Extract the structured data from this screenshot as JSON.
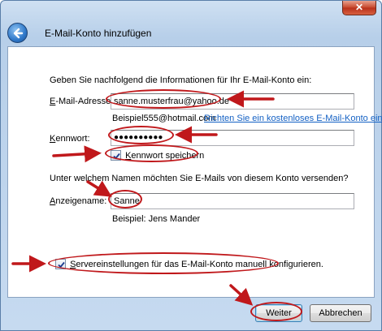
{
  "window": {
    "title": "E-Mail-Konto hinzufügen",
    "close_glyph": "✕",
    "back_icon": "back-arrow-icon"
  },
  "form": {
    "intro": "Geben Sie nachfolgend die Informationen für Ihr E-Mail-Konto ein:",
    "email_label_key": "E",
    "email_label_rest": "-Mail-Adresse:",
    "email_value": "sanne.musterfrau@yahoo.de",
    "email_example": "Beispiel555@hotmail.com",
    "free_account_link": "Richten Sie ein kostenloses E-Mail-Konto ein.",
    "password_label_key": "K",
    "password_label_rest": "ennwort:",
    "password_value": "●●●●●●●●●●",
    "remember_checked": true,
    "remember_label_key": "K",
    "remember_label_rest": "ennwort speichern",
    "sender_question": "Unter welchem Namen möchten Sie E-Mails von diesem Konto versenden?",
    "display_label_key": "A",
    "display_label_rest": "nzeigename:",
    "display_value": "Sanne",
    "display_example": "Beispiel: Jens Mander",
    "manual_checked": true,
    "manual_label_key": "S",
    "manual_label_rest": "ervereinstellungen für das E-Mail-Konto manuell konfigurieren."
  },
  "buttons": {
    "next": "Weiter",
    "cancel": "Abbrechen"
  },
  "colors": {
    "annotation": "#c0181b",
    "link": "#1461c4"
  }
}
